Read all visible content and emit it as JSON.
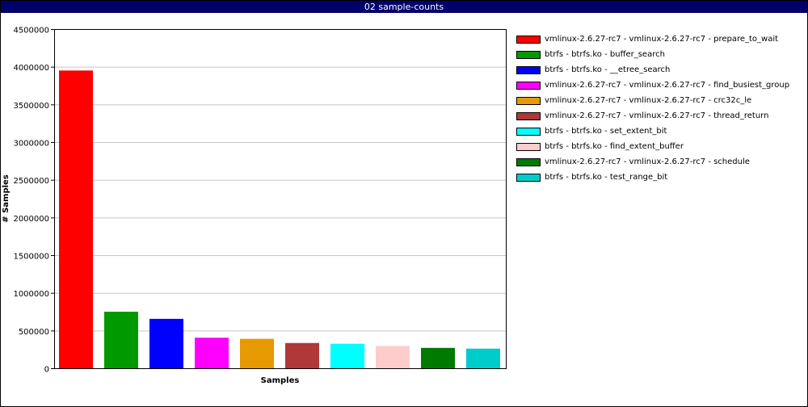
{
  "window": {
    "title": "02 sample-counts"
  },
  "chart_data": {
    "type": "bar",
    "title": "02 sample-counts",
    "xlabel": "Samples",
    "ylabel": "# Samples",
    "ylim": [
      0,
      4500000
    ],
    "yticks": [
      0,
      500000,
      1000000,
      1500000,
      2000000,
      2500000,
      3000000,
      3500000,
      4000000,
      4500000
    ],
    "ytick_labels": [
      "0",
      "500000",
      "1000000",
      "1500000",
      "2000000",
      "2500000",
      "3000000",
      "3500000",
      "4000000",
      "4500000"
    ],
    "grid": true,
    "legend_position": "right",
    "categories": [
      "vmlinux-2.6.27-rc7 - vmlinux-2.6.27-rc7 - prepare_to_wait",
      "btrfs - btrfs.ko - buffer_search",
      "btrfs - btrfs.ko - __etree_search",
      "vmlinux-2.6.27-rc7 - vmlinux-2.6.27-rc7 - find_busiest_group",
      "vmlinux-2.6.27-rc7 - vmlinux-2.6.27-rc7 - crc32c_le",
      "vmlinux-2.6.27-rc7 - vmlinux-2.6.27-rc7 - thread_return",
      "btrfs - btrfs.ko - set_extent_bit",
      "btrfs - btrfs.ko - find_extent_buffer",
      "vmlinux-2.6.27-rc7 - vmlinux-2.6.27-rc7 - schedule",
      "btrfs - btrfs.ko - test_range_bit"
    ],
    "values": [
      3950000,
      750000,
      655000,
      405000,
      390000,
      335000,
      325000,
      295000,
      270000,
      260000
    ],
    "colors": [
      "#ff0000",
      "#009900",
      "#0000ff",
      "#ff00ff",
      "#e69900",
      "#b03838",
      "#00ffff",
      "#ffcccc",
      "#007a00",
      "#00cccc"
    ]
  }
}
